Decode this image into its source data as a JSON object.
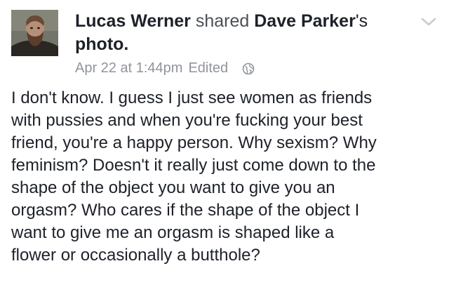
{
  "post": {
    "author": "Lucas Werner",
    "action": "shared",
    "shared_from": "Dave Parker",
    "shared_suffix": "'s",
    "object": "photo.",
    "date": "Apr 22 at 1:44pm",
    "edited": "Edited",
    "privacy_icon": "globe-icon",
    "menu_icon": "chevron-down-icon",
    "body_lines": [
      "I don't know. I guess I just see women as friends",
      "with pussies and when you're fucking your best",
      "friend, you're a happy person. Why sexism? Why",
      "feminism? Doesn't it really just come down to the",
      "shape of the object you want to give you an",
      "orgasm? Who cares if the shape of the object I",
      "want to give me an orgasm is shaped like a",
      "flower or occasionally a butthole?"
    ]
  },
  "colors": {
    "text": "#1d2129",
    "secondary": "#90949c",
    "chevron": "#c8ccd1"
  }
}
